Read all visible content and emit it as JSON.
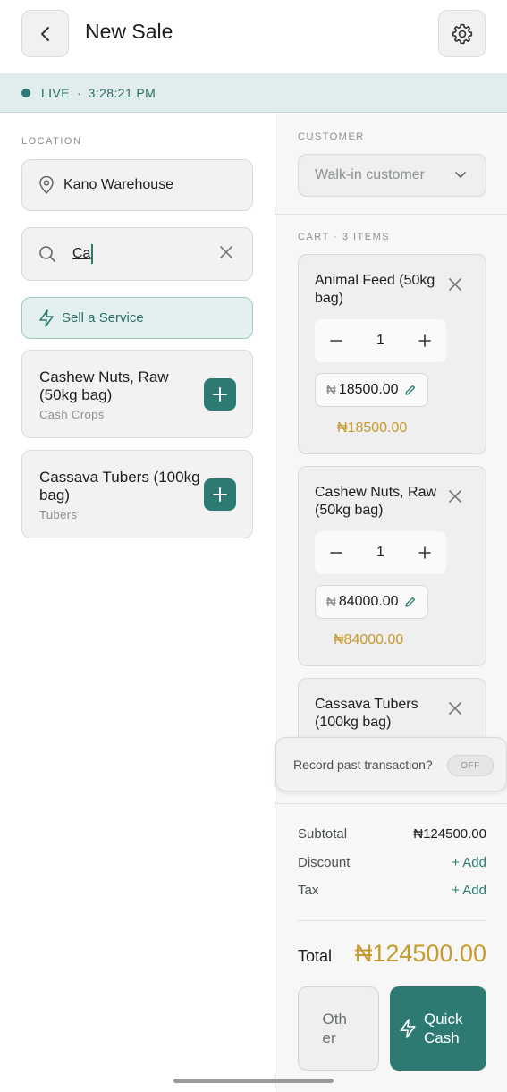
{
  "header": {
    "title": "New Sale"
  },
  "status": {
    "live_label": "LIVE",
    "separator": "·",
    "time": "3:28:21 PM"
  },
  "left": {
    "location_label": "LOCATION",
    "location_value": "Kano Warehouse",
    "search_value": "Ca",
    "service_button": "Sell a Service",
    "products": [
      {
        "name": "Cashew Nuts, Raw (50kg bag)",
        "category": "Cash Crops"
      },
      {
        "name": "Cassava Tubers (100kg bag)",
        "category": "Tubers"
      }
    ]
  },
  "right": {
    "customer_label": "CUSTOMER",
    "customer_value": "Walk-in customer",
    "cart_label": "CART · 3 ITEMS",
    "cart_items": [
      {
        "name": "Animal Feed (50kg bag)",
        "qty": "1",
        "currency": "₦",
        "price": "18500.00",
        "line_total": "₦18500.00"
      },
      {
        "name": "Cashew Nuts, Raw (50kg bag)",
        "qty": "1",
        "currency": "₦",
        "price": "84000.00",
        "line_total": "₦84000.00"
      },
      {
        "name": "Cassava Tubers (100kg bag)"
      }
    ],
    "record_past": "Record past transaction?",
    "record_toggle": "OFF",
    "subtotal_label": "Subtotal",
    "subtotal_value": "₦124500.00",
    "discount_label": "Discount",
    "discount_action": "+ Add",
    "tax_label": "Tax",
    "tax_action": "+ Add",
    "total_label": "Total",
    "total_value": "₦124500.00",
    "other_button": "Other",
    "quick_cash_button": "Quick Cash"
  },
  "colors": {
    "accent": "#2c7a72",
    "gold": "#c89a2e",
    "live_bar_bg": "#e1eced"
  }
}
